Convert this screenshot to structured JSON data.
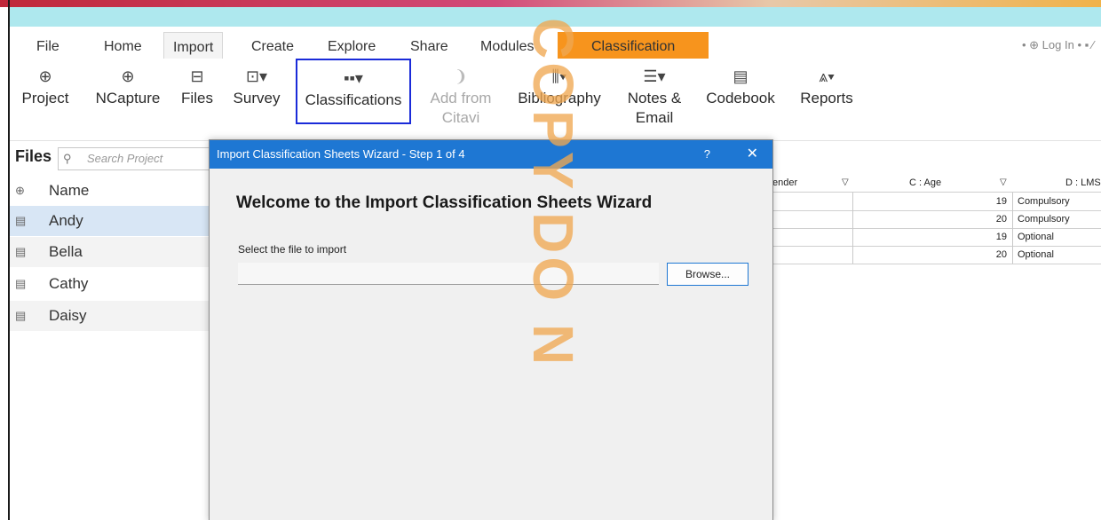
{
  "tabs": [
    "File",
    "Home",
    "Import",
    "Create",
    "Explore",
    "Share",
    "Modules",
    "Classification"
  ],
  "active_tab": "Import",
  "top_right": "• ⊕ Log In  •  ▪ ∕",
  "ribbon": [
    {
      "label1": "Project",
      "label2": "",
      "icon": "project-icon"
    },
    {
      "label1": "NCapture",
      "label2": "",
      "icon": "globe-icon"
    },
    {
      "label1": "Files",
      "label2": "",
      "icon": "files-icon"
    },
    {
      "label1": "Survey",
      "label2": "",
      "icon": "survey-icon"
    },
    {
      "label1": "Classifications",
      "label2": "",
      "icon": "classifications-icon"
    },
    {
      "label1": "Add from",
      "label2": "Citavi",
      "icon": "citavi-icon"
    },
    {
      "label1": "Bibliography",
      "label2": "",
      "icon": "bibliography-icon"
    },
    {
      "label1": "Notes &",
      "label2": "Email",
      "icon": "notes-icon"
    },
    {
      "label1": "Codebook",
      "label2": "",
      "icon": "codebook-icon"
    },
    {
      "label1": "Reports",
      "label2": "",
      "icon": "reports-icon"
    }
  ],
  "files_panel": {
    "title": "Files",
    "search_placeholder": "Search Project",
    "header": "Name",
    "rows": [
      "Andy",
      "Bella",
      "Cathy",
      "Daisy"
    ]
  },
  "sheet": {
    "col_gender": "ender",
    "col_age": "C : Age",
    "col_lms": "D : LMS",
    "rows": [
      {
        "age": "19",
        "lms": "Compulsory"
      },
      {
        "age": "20",
        "lms": "Compulsory"
      },
      {
        "age": "19",
        "lms": "Optional"
      },
      {
        "age": "20",
        "lms": "Optional"
      }
    ]
  },
  "dialog": {
    "title": "Import Classification Sheets Wizard - Step 1 of 4",
    "help": "?",
    "close": "✕",
    "heading": "Welcome to the Import Classification Sheets Wizard",
    "file_label": "Select the file to import",
    "file_value": "",
    "browse": "Browse..."
  },
  "watermark": {
    "line1": "COPY",
    "line2": "DO N"
  },
  "colors": {
    "classification_tab": "#f7941d",
    "dialog_title": "#1e77d3",
    "selected_row": "#d8e6f5",
    "highlight_box": "#1a2bd9"
  }
}
